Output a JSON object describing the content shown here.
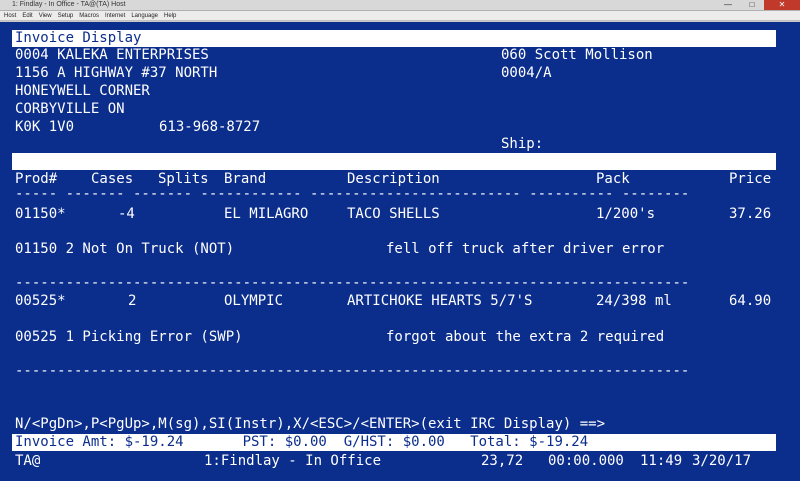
{
  "window": {
    "title": "1: Findlay - In Office - TA@(TA) Host",
    "controls": [
      "—",
      "□",
      "✕"
    ]
  },
  "menu": [
    "Host",
    "Edit",
    "View",
    "Setup",
    "Macros",
    "Internet",
    "Language",
    "Help"
  ],
  "screen": {
    "title": "Invoice Display",
    "customer": {
      "name": "0004 KALEKA ENTERPRISES",
      "address1": "1156 A HIGHWAY #37 NORTH",
      "address2": "HONEYWELL CORNER",
      "city": "CORBYVILLE ON",
      "postal": "K0K 1V0",
      "phone": "613-968-8727"
    },
    "rep": "060 Scott Mollison",
    "account": "0004/A",
    "ship_label": "Ship:",
    "columns": [
      "Prod#",
      "Cases",
      "Splits",
      "Brand",
      "Description",
      "Pack",
      "Price"
    ],
    "header_rule": "----- ------- ------- ------------ ------------------------- ---------- --------",
    "lines": [
      {
        "prod": "01150*",
        "cases": "-4",
        "brand": "EL MILAGRO",
        "description": "TACO SHELLS",
        "pack": "1/200's",
        "price": "37.26",
        "note": "01150 2 Not On Truck (NOT)",
        "comment": "fell off truck after driver error"
      },
      {
        "prod": "00525*",
        "cases": "2",
        "brand": "OLYMPIC",
        "description": "ARTICHOKE HEARTS 5/7'S",
        "pack": "24/398 ml",
        "price": "64.90",
        "note": "00525 1 Picking Error (SWP)",
        "comment": "forgot about the extra 2 required"
      }
    ],
    "dash_rule": "--------------------------------------------------------------------------------",
    "command_line": "N/<PgDn>,P<PgUp>,M(sg),SI(Instr),X/<ESC>/<ENTER>(exit IRC Display) ==>",
    "totals": "Invoice Amt: $-19.24       PST: $0.00  G/HST: $0.00   Total: $-19.24"
  },
  "status": {
    "user": "TA@",
    "session": "1:Findlay - In Office",
    "cursor": "23,72",
    "timer": "00:00.000",
    "time": "11:49",
    "date": "3/20/17"
  }
}
